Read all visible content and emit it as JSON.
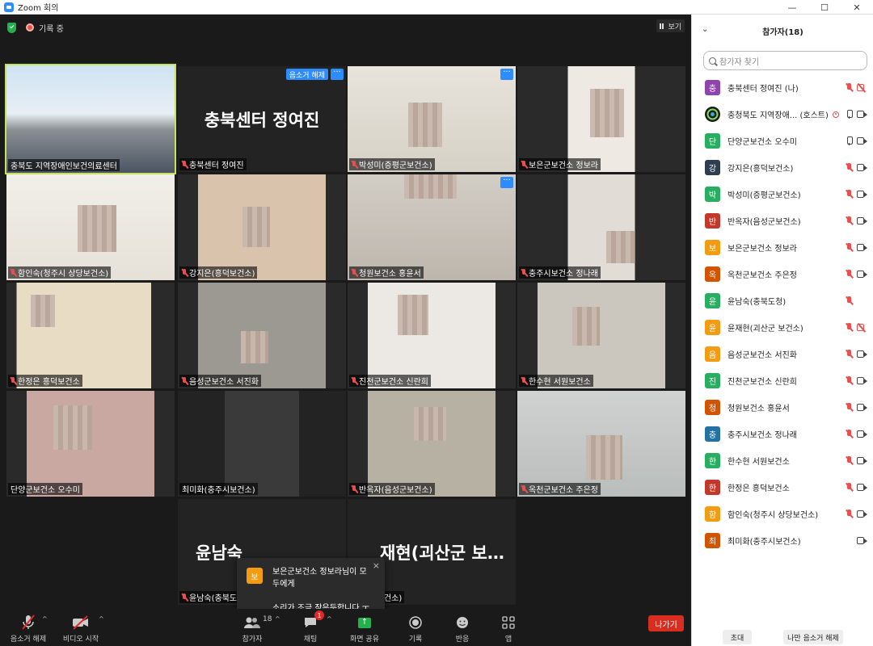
{
  "window": {
    "title": "Zoom 회의",
    "minimize": "—",
    "maximize": "☐",
    "close": "✕"
  },
  "topbar": {
    "recording": "기록 중",
    "view": "보기"
  },
  "tiles": [
    {
      "name": "충북도 지역장애인보건의료센터",
      "muted": false
    },
    {
      "name": "충북센터 정여진",
      "big": "충북센터 정여진",
      "muted": true,
      "unmute": "음소거 해제"
    },
    {
      "name": "박성미(증평군보건소)",
      "muted": true
    },
    {
      "name": "보은군보건소 정보라",
      "muted": true
    },
    {
      "name": "함인숙(청주시 상당보건소)",
      "muted": true
    },
    {
      "name": "강지은(흥덕보건소)",
      "muted": true
    },
    {
      "name": "청원보건소 홍윤서",
      "muted": true
    },
    {
      "name": "충주시보건소 정나래",
      "muted": true
    },
    {
      "name": "한정은 흥덕보건소",
      "muted": true
    },
    {
      "name": "음성군보건소 서진화",
      "muted": true
    },
    {
      "name": "진천군보건소 신란희",
      "muted": true
    },
    {
      "name": "한수현 서원보건소",
      "muted": true
    },
    {
      "name": "단양군보건소 오수미",
      "muted": false
    },
    {
      "name": "최미화(충주시보건소)",
      "muted": false
    },
    {
      "name": "반옥자(음성군보건소)",
      "muted": true
    },
    {
      "name": "옥천군보건소 주은정",
      "muted": true
    },
    {
      "name": "윤남숙(충북도",
      "big": "윤남숙",
      "muted": true
    },
    {
      "name": "괴산군 보건소)",
      "big": "재현(괴산군 보…",
      "muted": false
    }
  ],
  "tile_more": "···",
  "chat_popup": {
    "avatar": "보",
    "from": "보은군보건소 정보라님이 모두에게",
    "message": "소리가 조금 작은듯합니다 ㅜ",
    "close": "×"
  },
  "toolbar": {
    "mute": "음소거 해제",
    "video": "비디오 시작",
    "participants": "참가자",
    "participants_count": "18",
    "chat": "채팅",
    "chat_badge": "1",
    "share": "화면 공유",
    "record": "기록",
    "reactions": "반응",
    "apps": "앱",
    "leave": "나가기"
  },
  "panel": {
    "title": "참가자(18)",
    "search_placeholder": "참가자 찾기",
    "invite": "초대",
    "unmute_me": "나만 음소거 해제",
    "participants": [
      {
        "avatar": "충",
        "name": "충북센터 정여진 (나)",
        "color": "#8e44ad",
        "mic": "off",
        "cam": "off"
      },
      {
        "avatar": "",
        "name": "충청북도 지역장애... (호스트)",
        "color": "#1a1a1a",
        "mic": "on",
        "cam": "on",
        "rec": true
      },
      {
        "avatar": "단",
        "name": "단양군보건소 오수미",
        "color": "#27ae60",
        "mic": "on",
        "cam": "on"
      },
      {
        "avatar": "강",
        "name": "강지은(흥덕보건소)",
        "color": "#2c3e50",
        "mic": "off",
        "cam": "on"
      },
      {
        "avatar": "박",
        "name": "박성미(증평군보건소)",
        "color": "#27ae60",
        "mic": "off",
        "cam": "on"
      },
      {
        "avatar": "반",
        "name": "반옥자(음성군보건소)",
        "color": "#c0392b",
        "mic": "off",
        "cam": "on"
      },
      {
        "avatar": "보",
        "name": "보은군보건소 정보라",
        "color": "#f39c12",
        "mic": "off",
        "cam": "on"
      },
      {
        "avatar": "옥",
        "name": "옥천군보건소 주은정",
        "color": "#d35400",
        "mic": "off",
        "cam": "on"
      },
      {
        "avatar": "윤",
        "name": "윤남숙(충북도청)",
        "color": "#27ae60",
        "mic": "off",
        "cam": "none"
      },
      {
        "avatar": "윤",
        "name": "윤재현(괴산군 보건소)",
        "color": "#f39c12",
        "mic": "off",
        "cam": "off"
      },
      {
        "avatar": "음",
        "name": "음성군보건소 서진화",
        "color": "#f39c12",
        "mic": "off",
        "cam": "on"
      },
      {
        "avatar": "진",
        "name": "진천군보건소 신란희",
        "color": "#27ae60",
        "mic": "off",
        "cam": "on"
      },
      {
        "avatar": "청",
        "name": "청원보건소 홍윤서",
        "color": "#d35400",
        "mic": "off",
        "cam": "on"
      },
      {
        "avatar": "충",
        "name": "충주시보건소 정나래",
        "color": "#2471a3",
        "mic": "off",
        "cam": "on"
      },
      {
        "avatar": "한",
        "name": "한수현 서원보건소",
        "color": "#27ae60",
        "mic": "off",
        "cam": "on"
      },
      {
        "avatar": "한",
        "name": "한정은 흥덕보건소",
        "color": "#c0392b",
        "mic": "off",
        "cam": "on"
      },
      {
        "avatar": "함",
        "name": "함인숙(청주시 상당보건소)",
        "color": "#f39c12",
        "mic": "off",
        "cam": "on"
      },
      {
        "avatar": "최",
        "name": "최미화(충주시보건소)",
        "color": "#d35400",
        "mic": "none",
        "cam": "on"
      }
    ]
  }
}
